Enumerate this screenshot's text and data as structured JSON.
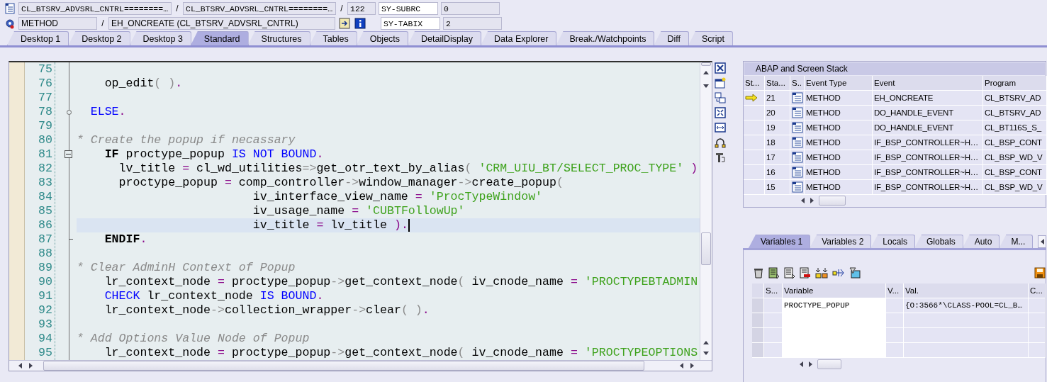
{
  "location": {
    "class_pool": "CL_BTSRV_ADVSRL_CNTRL========…",
    "separator_1": "/",
    "include": "CL_BTSRV_ADVSRL_CNTRL========…",
    "separator_2": "/",
    "line": "122",
    "event_type": "METHOD",
    "separator_3": "/",
    "event": "EH_ONCREATE (CL_BTSRV_ADVSRL_CNTRL)"
  },
  "system_fields": [
    {
      "name": "SY-SUBRC",
      "value": "0"
    },
    {
      "name": "SY-TABIX",
      "value": "2"
    }
  ],
  "tabs": [
    {
      "label": "Desktop 1",
      "selected": false
    },
    {
      "label": "Desktop 2",
      "selected": false
    },
    {
      "label": "Desktop 3",
      "selected": false
    },
    {
      "label": "Standard",
      "selected": true
    },
    {
      "label": "Structures",
      "selected": false
    },
    {
      "label": "Tables",
      "selected": false
    },
    {
      "label": "Objects",
      "selected": false
    },
    {
      "label": "DetailDisplay",
      "selected": false
    },
    {
      "label": "Data Explorer",
      "selected": false
    },
    {
      "label": "Break./Watchpoints",
      "selected": false
    },
    {
      "label": "Diff",
      "selected": false
    },
    {
      "label": "Script",
      "selected": false
    }
  ],
  "editor": {
    "lines": [
      {
        "number": "75",
        "kind": "plain",
        "current": false
      },
      {
        "number": "76",
        "kind": "plain",
        "current": false,
        "segments": [
          {
            "kind": "plain",
            "text": "    op_edit"
          },
          {
            "kind": "paren",
            "text": "( )"
          },
          {
            "kind": "operator",
            "text": "."
          }
        ]
      },
      {
        "number": "77",
        "kind": "plain",
        "current": false
      },
      {
        "number": "78",
        "kind": "branch",
        "current": false,
        "segments": [
          {
            "kind": "keyword",
            "text": "  ELSE"
          },
          {
            "kind": "operator",
            "text": "."
          }
        ]
      },
      {
        "number": "79",
        "kind": "plain",
        "current": false
      },
      {
        "number": "80",
        "kind": "plain",
        "current": false,
        "segments": [
          {
            "kind": "comment",
            "text": "* Create the popup if necassary"
          }
        ]
      },
      {
        "number": "81",
        "kind": "block_start",
        "current": false,
        "segments": [
          {
            "kind": "statement",
            "text": "    IF"
          },
          {
            "kind": "plain",
            "text": " proctype_popup "
          },
          {
            "kind": "keyword",
            "text": "IS NOT BOUND"
          },
          {
            "kind": "operator",
            "text": "."
          }
        ]
      },
      {
        "number": "82",
        "kind": "plain",
        "current": false,
        "segments": [
          {
            "kind": "plain",
            "text": "      lv_title "
          },
          {
            "kind": "operator",
            "text": "="
          },
          {
            "kind": "plain",
            "text": " cl_wd_utilities"
          },
          {
            "kind": "paren",
            "text": "=>"
          },
          {
            "kind": "plain",
            "text": "get_otr_text_by_alias"
          },
          {
            "kind": "paren",
            "text": "( "
          },
          {
            "kind": "string",
            "text": "'CRM_UIU_BT/SELECT_PROC_TYPE'"
          },
          {
            "kind": "operator",
            "text": " )"
          }
        ]
      },
      {
        "number": "83",
        "kind": "plain",
        "current": false,
        "segments": [
          {
            "kind": "plain",
            "text": "      proctype_popup "
          },
          {
            "kind": "operator",
            "text": "="
          },
          {
            "kind": "plain",
            "text": " comp_controller"
          },
          {
            "kind": "paren",
            "text": "->"
          },
          {
            "kind": "plain",
            "text": "window_manager"
          },
          {
            "kind": "paren",
            "text": "->"
          },
          {
            "kind": "plain",
            "text": "create_popup"
          },
          {
            "kind": "paren",
            "text": "("
          }
        ]
      },
      {
        "number": "84",
        "kind": "plain",
        "current": false,
        "segments": [
          {
            "kind": "plain",
            "text": "                         iv_interface_view_name "
          },
          {
            "kind": "operator",
            "text": "= "
          },
          {
            "kind": "string",
            "text": "'ProcTypeWindow'"
          }
        ]
      },
      {
        "number": "85",
        "kind": "plain",
        "current": false,
        "segments": [
          {
            "kind": "plain",
            "text": "                         iv_usage_name "
          },
          {
            "kind": "operator",
            "text": "= "
          },
          {
            "kind": "string",
            "text": "'CUBTFollowUp'"
          }
        ]
      },
      {
        "number": "86",
        "kind": "plain",
        "current": true,
        "segments": [
          {
            "kind": "plain",
            "text": "                         iv_title "
          },
          {
            "kind": "operator",
            "text": "="
          },
          {
            "kind": "plain",
            "text": " lv_title "
          },
          {
            "kind": "operator",
            "text": ")."
          }
        ]
      },
      {
        "number": "87",
        "kind": "block_end",
        "current": false,
        "segments": [
          {
            "kind": "statement",
            "text": "    ENDIF"
          },
          {
            "kind": "operator",
            "text": "."
          }
        ]
      },
      {
        "number": "88",
        "kind": "plain",
        "current": false
      },
      {
        "number": "89",
        "kind": "plain",
        "current": false,
        "segments": [
          {
            "kind": "comment",
            "text": "* Clear AdminH Context of Popup"
          }
        ]
      },
      {
        "number": "90",
        "kind": "plain",
        "current": false,
        "segments": [
          {
            "kind": "plain",
            "text": "    lr_context_node "
          },
          {
            "kind": "operator",
            "text": "="
          },
          {
            "kind": "plain",
            "text": " proctype_popup"
          },
          {
            "kind": "paren",
            "text": "->"
          },
          {
            "kind": "plain",
            "text": "get_context_node"
          },
          {
            "kind": "paren",
            "text": "( "
          },
          {
            "kind": "plain",
            "text": "iv_cnode_name "
          },
          {
            "kind": "operator",
            "text": "= "
          },
          {
            "kind": "string",
            "text": "'PROCTYPEBTADMIN"
          }
        ]
      },
      {
        "number": "91",
        "kind": "plain",
        "current": false,
        "segments": [
          {
            "kind": "keyword",
            "text": "    CHECK"
          },
          {
            "kind": "plain",
            "text": " lr_context_node "
          },
          {
            "kind": "keyword",
            "text": "IS BOUND"
          },
          {
            "kind": "operator",
            "text": "."
          }
        ]
      },
      {
        "number": "92",
        "kind": "plain",
        "current": false,
        "segments": [
          {
            "kind": "plain",
            "text": "    lr_context_node"
          },
          {
            "kind": "paren",
            "text": "->"
          },
          {
            "kind": "plain",
            "text": "collection_wrapper"
          },
          {
            "kind": "paren",
            "text": "->"
          },
          {
            "kind": "plain",
            "text": "clear"
          },
          {
            "kind": "paren",
            "text": "( )"
          },
          {
            "kind": "operator",
            "text": "."
          }
        ]
      },
      {
        "number": "93",
        "kind": "plain",
        "current": false
      },
      {
        "number": "94",
        "kind": "plain",
        "current": false,
        "segments": [
          {
            "kind": "comment",
            "text": "* Add Options Value Node of Popup"
          }
        ]
      },
      {
        "number": "95",
        "kind": "plain",
        "current": false,
        "segments": [
          {
            "kind": "plain",
            "text": "    lr_context_node "
          },
          {
            "kind": "operator",
            "text": "="
          },
          {
            "kind": "plain",
            "text": " proctype_popup"
          },
          {
            "kind": "paren",
            "text": "->"
          },
          {
            "kind": "plain",
            "text": "get_context_node"
          },
          {
            "kind": "paren",
            "text": "( "
          },
          {
            "kind": "plain",
            "text": "iv_cnode_name "
          },
          {
            "kind": "operator",
            "text": "= "
          },
          {
            "kind": "string",
            "text": "'PROCTYPEOPTIONS"
          }
        ]
      }
    ]
  },
  "stack": {
    "title": "ABAP and Screen Stack",
    "columns": [
      "St...",
      "Sta...",
      "S..",
      "Event Type",
      "Event",
      "Program"
    ],
    "rows": [
      {
        "current": true,
        "stack_level": "21",
        "event_type": "METHOD",
        "event": "EH_ONCREATE",
        "program": "CL_BTSRV_AD"
      },
      {
        "current": false,
        "stack_level": "20",
        "event_type": "METHOD",
        "event": "DO_HANDLE_EVENT",
        "program": "CL_BTSRV_AD"
      },
      {
        "current": false,
        "stack_level": "19",
        "event_type": "METHOD",
        "event": "DO_HANDLE_EVENT",
        "program": "CL_BT116S_S_"
      },
      {
        "current": false,
        "stack_level": "18",
        "event_type": "METHOD",
        "event": "IF_BSP_CONTROLLER~H…",
        "program": "CL_BSP_CONT"
      },
      {
        "current": false,
        "stack_level": "17",
        "event_type": "METHOD",
        "event": "IF_BSP_CONTROLLER~H…",
        "program": "CL_BSP_WD_V"
      },
      {
        "current": false,
        "stack_level": "16",
        "event_type": "METHOD",
        "event": "IF_BSP_CONTROLLER~H…",
        "program": "CL_BSP_CONT"
      },
      {
        "current": false,
        "stack_level": "15",
        "event_type": "METHOD",
        "event": "IF_BSP_CONTROLLER~H…",
        "program": "CL_BSP_WD_V"
      }
    ]
  },
  "variable_tabs": [
    {
      "label": "Variables 1",
      "selected": true
    },
    {
      "label": "Variables 2",
      "selected": false
    },
    {
      "label": "Locals",
      "selected": false
    },
    {
      "label": "Globals",
      "selected": false
    },
    {
      "label": "Auto",
      "selected": false
    },
    {
      "label": "M...",
      "selected": false
    }
  ],
  "variables": {
    "columns": [
      "S...",
      "Variable",
      "V...",
      "Val.",
      "C..."
    ],
    "rows": [
      {
        "variable": "PROCTYPE_POPUP",
        "value": "{O:3566*\\CLASS-POOL=CL_B…"
      }
    ]
  }
}
